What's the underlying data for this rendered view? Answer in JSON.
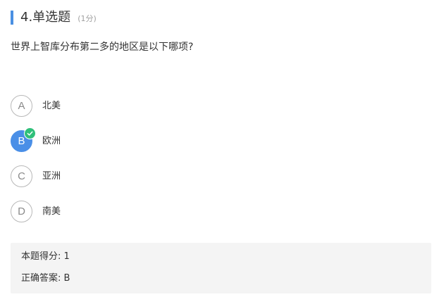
{
  "question": {
    "title": "4.单选题",
    "score_note": "(1分)",
    "stem": "世界上智库分布第二多的地区是以下哪项?"
  },
  "options": [
    {
      "letter": "A",
      "text": "北美",
      "selected": false
    },
    {
      "letter": "B",
      "text": "欧洲",
      "selected": true
    },
    {
      "letter": "C",
      "text": "亚洲",
      "selected": false
    },
    {
      "letter": "D",
      "text": "南美",
      "selected": false
    }
  ],
  "result": {
    "score_label": "本题得分:",
    "score_value": "1",
    "answer_label": "正确答案:",
    "answer_value": "B"
  },
  "colors": {
    "accent": "#4a90e2",
    "selected": "#4a8fe7",
    "correct_check": "#2fc07a",
    "panel_bg": "#f4f4f4"
  },
  "icons": {
    "correct_mark": "check-icon"
  }
}
